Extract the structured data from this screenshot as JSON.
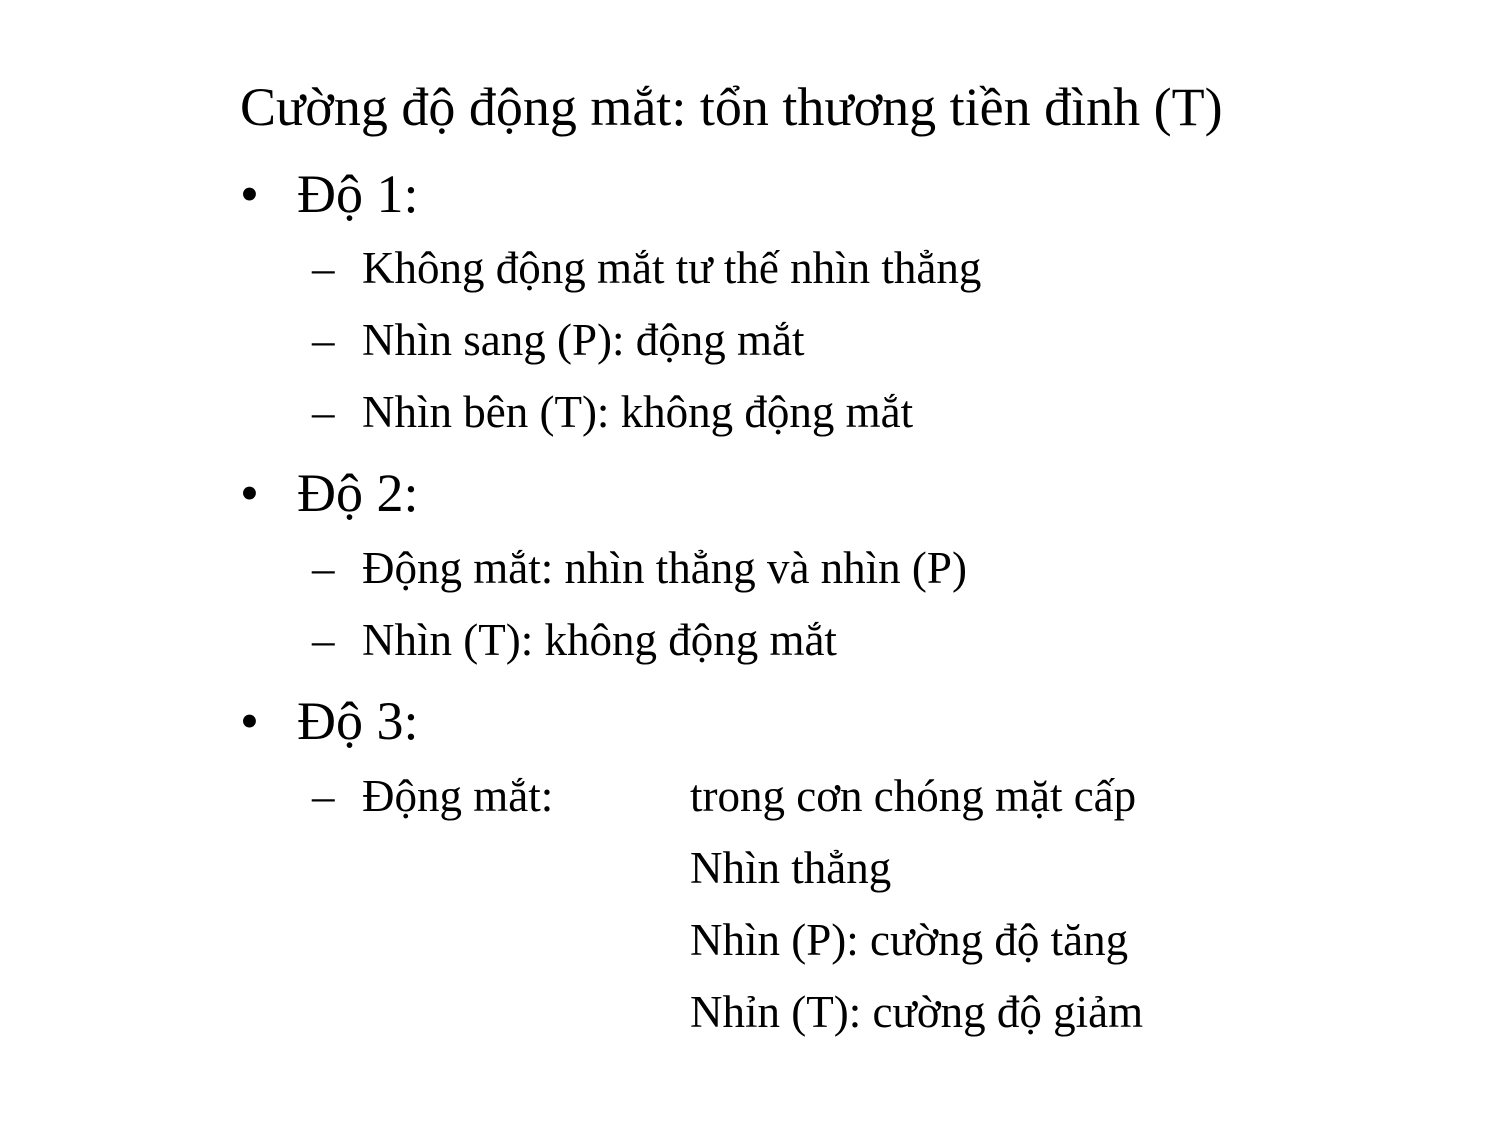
{
  "title": "Cường độ động mắt: tổn thương tiền đình (T)",
  "bullet_symbol": "•",
  "dash_symbol": "–",
  "grades": [
    {
      "label": "Độ 1:",
      "items": [
        "Không động mắt tư thế nhìn thẳng",
        "Nhìn sang (P): động mắt",
        "Nhìn bên (T): không động mắt"
      ]
    },
    {
      "label": "Độ 2:",
      "items": [
        "Động mắt: nhìn thẳng và nhìn (P)",
        "Nhìn (T): không động mắt"
      ]
    },
    {
      "label": "Độ 3:",
      "item_label": "Động mắt:",
      "item_lines": [
        "trong cơn chóng mặt cấp",
        "Nhìn thẳng",
        "Nhìn (P): cường độ tăng",
        "Nhỉn (T): cường độ giảm"
      ]
    }
  ]
}
